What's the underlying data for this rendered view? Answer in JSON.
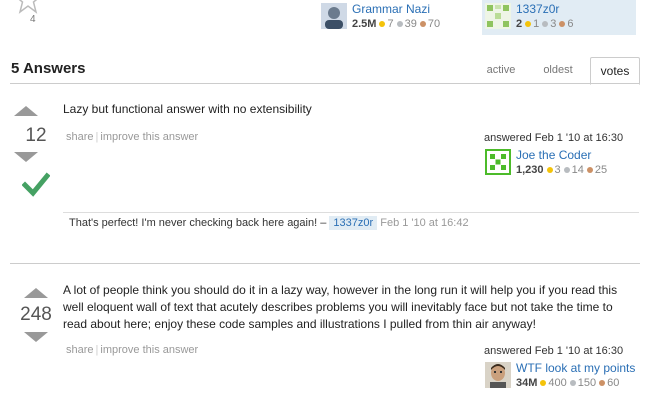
{
  "question": {
    "favorite_count": "4"
  },
  "op_card": {
    "username": "Grammar Nazi",
    "reputation": "2.5M",
    "gold": "7",
    "silver": "39",
    "bronze": "70"
  },
  "asker_card": {
    "username": "1337z0r",
    "reputation": "2",
    "gold": "1",
    "silver": "3",
    "bronze": "6"
  },
  "answers_header": {
    "title": "5 Answers",
    "tabs": [
      {
        "label": "active"
      },
      {
        "label": "oldest"
      },
      {
        "label": "votes"
      }
    ]
  },
  "answers": [
    {
      "votes": "12",
      "accepted": true,
      "body": "Lazy but functional answer with no extensibility",
      "menu": {
        "share": "share",
        "improve": "improve this answer"
      },
      "answered": "answered Feb 1 '10 at 16:30",
      "user": {
        "name": "Joe the Coder",
        "reputation": "1,230",
        "gold": "3",
        "silver": "14",
        "bronze": "25"
      },
      "comment": {
        "text": "That's perfect! I'm never checking back here again! –",
        "user": "1337z0r",
        "date": "Feb 1 '10 at 16:42"
      }
    },
    {
      "votes": "248",
      "accepted": false,
      "body_lines": [
        "A lot of people think you should do it in a lazy way, however in the long run it will help you if you read this",
        "well eloquent wall of text that acutely describes problems you will inevitably face but not take the time to",
        "read about here; enjoy these code samples and illustrations I pulled from thin air anyway!"
      ],
      "menu": {
        "share": "share",
        "improve": "improve this answer"
      },
      "answered": "answered Feb 1 '10 at 16:30",
      "user": {
        "name": "WTF look at my points",
        "reputation": "34M",
        "gold": "400",
        "silver": "150",
        "bronze": "60"
      }
    }
  ],
  "colors": {
    "link": "#2a6fb5",
    "accepted_check": "#45a163",
    "asker_highlight": "#e1ecf4"
  }
}
